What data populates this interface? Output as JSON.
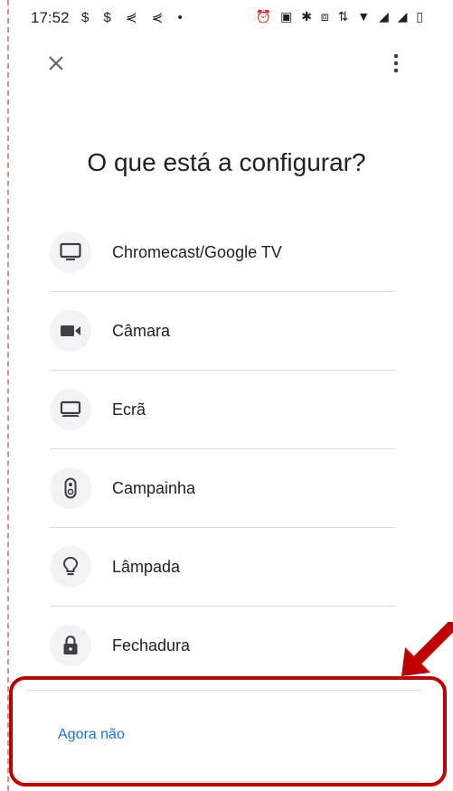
{
  "status_bar": {
    "time": "17:52",
    "left_icons": "$ $ ⋞ ⋞ •",
    "right_icons": "⏰ ▣ ✱ ⧈ ⇅ ▼ ◢ ◢ ▯"
  },
  "app_bar": {
    "close_icon": "close-icon",
    "menu_icon": "more-vert-icon"
  },
  "title": "O que está a configurar?",
  "devices": [
    {
      "label": "Chromecast/Google TV",
      "icon": "tv-icon"
    },
    {
      "label": "Câmara",
      "icon": "camera-icon"
    },
    {
      "label": "Ecrã",
      "icon": "display-icon"
    },
    {
      "label": "Campainha",
      "icon": "doorbell-icon"
    },
    {
      "label": "Lâmpada",
      "icon": "lightbulb-icon"
    },
    {
      "label": "Fechadura",
      "icon": "lock-icon"
    }
  ],
  "actions": {
    "not_now": "Agora não"
  },
  "colors": {
    "accent": "#1a73e8",
    "icon": "#3c4043",
    "icon_bg": "#f1f3f4",
    "annotation": "#c00000"
  }
}
